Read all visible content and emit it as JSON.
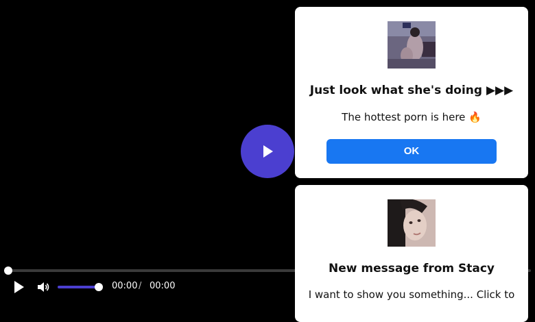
{
  "player": {
    "big_play_icon": "play-icon",
    "controls": {
      "play_icon": "play-icon",
      "volume_icon": "speaker-icon",
      "volume_level": 0.9,
      "progress_fraction": 0,
      "current_time": "00:00",
      "separator": "/",
      "total_time": "00:00"
    },
    "accent_color": "#4b3fd0"
  },
  "popups": [
    {
      "title": "Just look what she's doing ▶▶▶",
      "subtitle": "The hottest porn is here 🔥",
      "button_label": "OK",
      "button_color": "#1877f2"
    },
    {
      "title": "New message from Stacy",
      "subtitle": "I want to show you something... Click to"
    }
  ]
}
